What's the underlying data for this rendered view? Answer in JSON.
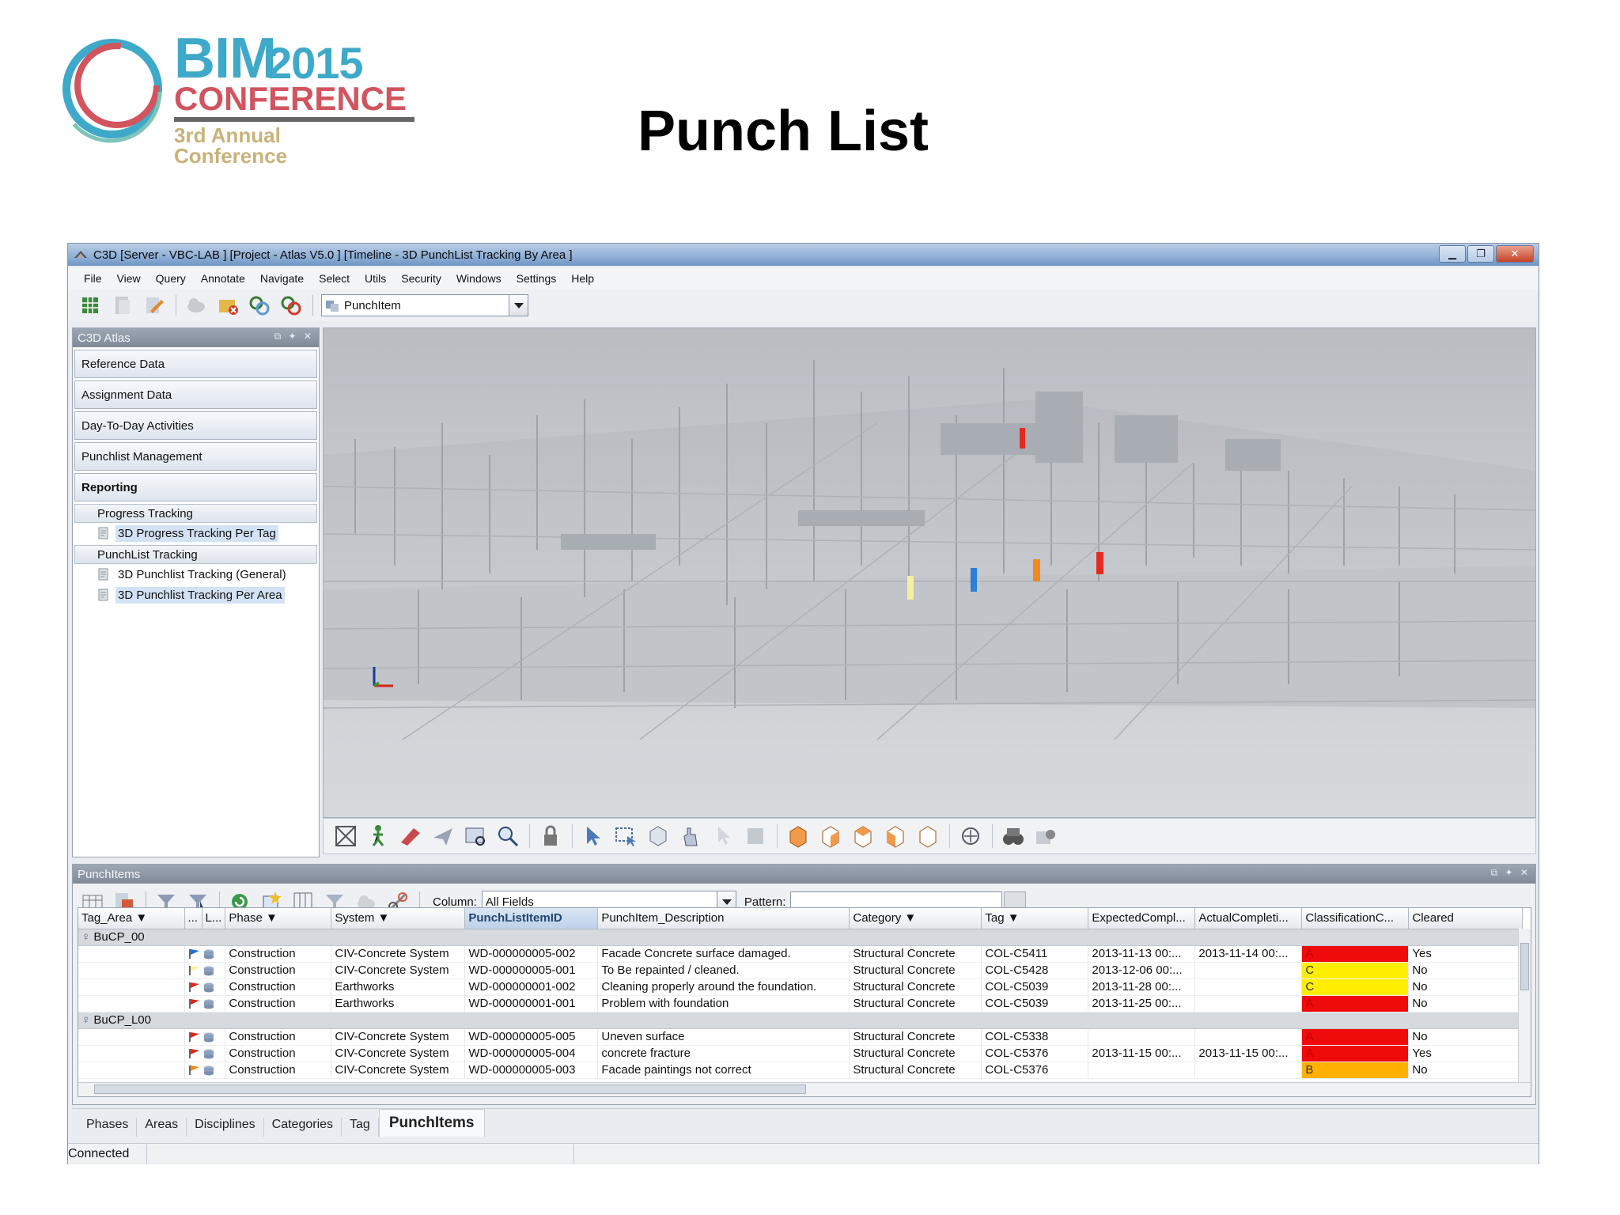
{
  "slide": {
    "logo": {
      "bim": "BIM",
      "year": "2015",
      "conference": "CONFERENCE",
      "subtitle": "3rd Annual Conference"
    },
    "title": "Punch List"
  },
  "window": {
    "title": "C3D [Server - VBC-LAB ] [Project - Atlas V5.0 ] [Timeline - 3D PunchList Tracking By Area ]",
    "controls": [
      "minimize",
      "restore",
      "close"
    ]
  },
  "menu": [
    "File",
    "View",
    "Query",
    "Annotate",
    "Navigate",
    "Select",
    "Utils",
    "Security",
    "Windows",
    "Settings",
    "Help"
  ],
  "toolbar": {
    "entity_selector": "PunchItem"
  },
  "atlas_panel": {
    "title": "C3D Atlas",
    "sections": [
      {
        "label": "Reference Data"
      },
      {
        "label": "Assignment Data"
      },
      {
        "label": "Day-To-Day Activities"
      },
      {
        "label": "Punchlist Management"
      },
      {
        "label": "Reporting"
      }
    ],
    "groups": [
      {
        "label": "Progress Tracking",
        "items": [
          {
            "label": "3D Progress Tracking Per Tag",
            "selected": true
          }
        ]
      },
      {
        "label": "PunchList Tracking",
        "items": [
          {
            "label": "3D Punchlist Tracking (General)",
            "selected": false
          },
          {
            "label": "3D Punchlist Tracking Per Area",
            "selected": true
          }
        ]
      }
    ]
  },
  "punch_panel": {
    "title": "PunchItems",
    "column_label": "Column:",
    "column_value": "All Fields",
    "pattern_label": "Pattern:",
    "pattern_value": "",
    "columns": [
      "Tag_Area ▼",
      "...",
      "L...",
      "Phase ▼",
      "System ▼",
      "PunchListItemID",
      "PunchItem_Description",
      "Category ▼",
      "Tag ▼",
      "ExpectedCompl...",
      "ActualCompleti...",
      "ClassificationC...",
      "Cleared"
    ],
    "groups": [
      {
        "name": "BuCP_00",
        "rows": [
          {
            "flag": "blue",
            "phase": "Construction",
            "system": "CIV-Concrete System",
            "id": "WD-000000005-002",
            "desc": "Facade Concrete surface damaged.",
            "category": "Structural Concrete",
            "tag": "COL-C5411",
            "expected": "2013-11-13 00:...",
            "actual": "2013-11-14 00:...",
            "class": "A",
            "class_color": "#f00b0b",
            "cleared": "Yes"
          },
          {
            "flag": "yellow",
            "phase": "Construction",
            "system": "CIV-Concrete System",
            "id": "WD-000000005-001",
            "desc": "To Be repainted / cleaned.",
            "category": "Structural Concrete",
            "tag": "COL-C5428",
            "expected": "2013-12-06 00:...",
            "actual": "",
            "class": "C",
            "class_color": "#ffee00",
            "cleared": "No"
          },
          {
            "flag": "red",
            "phase": "Construction",
            "system": "Earthworks",
            "id": "WD-000000001-002",
            "desc": "Cleaning properly around the foundation.",
            "category": "Structural Concrete",
            "tag": "COL-C5039",
            "expected": "2013-11-28 00:...",
            "actual": "",
            "class": "C",
            "class_color": "#ffee00",
            "cleared": "No"
          },
          {
            "flag": "red",
            "phase": "Construction",
            "system": "Earthworks",
            "id": "WD-000000001-001",
            "desc": "Problem with foundation",
            "category": "Structural Concrete",
            "tag": "COL-C5039",
            "expected": "2013-11-25 00:...",
            "actual": "",
            "class": "A",
            "class_color": "#f00b0b",
            "cleared": "No"
          }
        ]
      },
      {
        "name": "BuCP_L00",
        "rows": [
          {
            "flag": "red",
            "phase": "Construction",
            "system": "CIV-Concrete System",
            "id": "WD-000000005-005",
            "desc": "Uneven surface",
            "category": "Structural Concrete",
            "tag": "COL-C5338",
            "expected": "",
            "actual": "",
            "class": "A",
            "class_color": "#f00b0b",
            "cleared": "No"
          },
          {
            "flag": "red",
            "phase": "Construction",
            "system": "CIV-Concrete System",
            "id": "WD-000000005-004",
            "desc": "concrete fracture",
            "category": "Structural Concrete",
            "tag": "COL-C5376",
            "expected": "2013-11-15 00:...",
            "actual": "2013-11-15 00:...",
            "class": "A",
            "class_color": "#f00b0b",
            "cleared": "Yes"
          },
          {
            "flag": "orange",
            "phase": "Construction",
            "system": "CIV-Concrete System",
            "id": "WD-000000005-003",
            "desc": "Facade paintings not correct",
            "category": "Structural Concrete",
            "tag": "COL-C5376",
            "expected": "",
            "actual": "",
            "class": "B",
            "class_color": "#ffb000",
            "cleared": "No"
          }
        ]
      }
    ]
  },
  "tabs": [
    "Phases",
    "Areas",
    "Disciplines",
    "Categories",
    "Tag",
    "PunchItems"
  ],
  "active_tab": "PunchItems",
  "status": {
    "text": "Connected"
  }
}
